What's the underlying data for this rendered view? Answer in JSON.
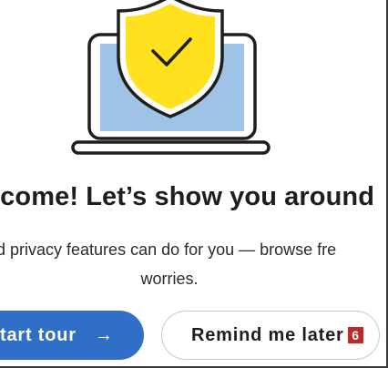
{
  "welcome": {
    "title": "lcome! Let’s show you around",
    "subtitle_line1": "d privacy features can do for you — browse fre",
    "subtitle_line2": "worries."
  },
  "actions": {
    "start_tour_label": "tart tour",
    "start_tour_icon": "arrow-right-icon",
    "remind_later_label": "Remind me later",
    "remind_later_badge": "6"
  },
  "illustration": {
    "icon": "laptop-shield-check-icon"
  },
  "colors": {
    "primary": "#2f6fc8",
    "shield_yellow": "#ffe11e",
    "screen_blue": "#9fc3e6",
    "badge_red": "#c0292b"
  }
}
